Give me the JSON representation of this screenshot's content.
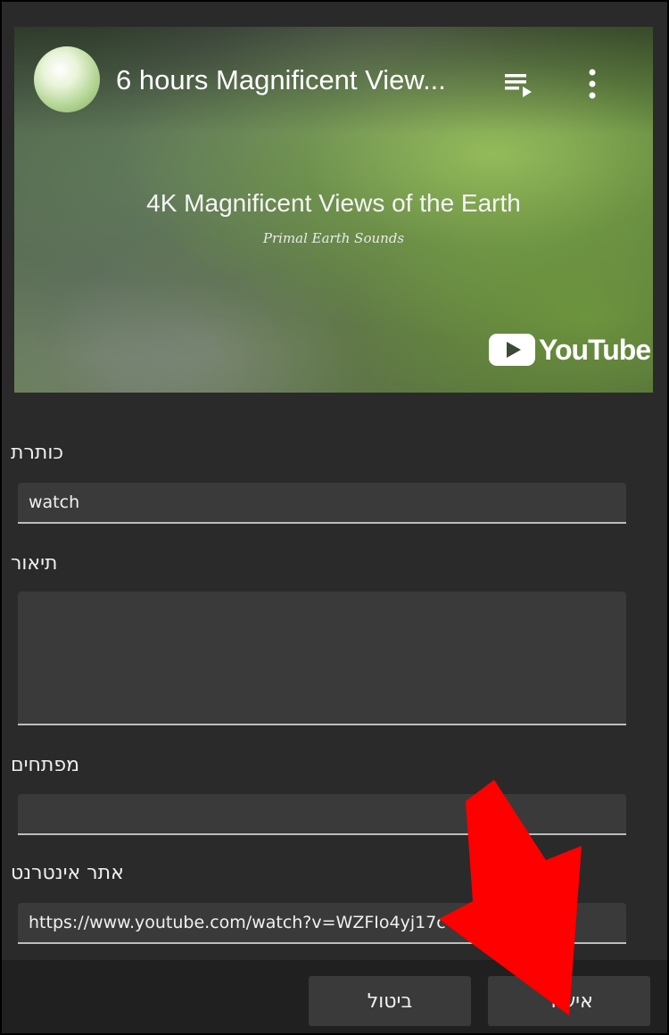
{
  "video": {
    "title": "6 hours Magnificent View...",
    "overlay_title": "4K Magnificent Views of the Earth",
    "overlay_subtitle": "Primal Earth Sounds",
    "brand": "YouTube",
    "brand_color": "#ffffff",
    "playlist_icon": "playlist-play-icon",
    "more_icon": "more-vert-icon"
  },
  "form": {
    "title_label": "כותרת",
    "title_value": "watch",
    "description_label": "תיאור",
    "description_value": "",
    "keywords_label": "מפתחים",
    "keywords_value": "",
    "website_label": "אתר אינטרנט",
    "website_value": "https://www.youtube.com/watch?v=WZFIo4yj17c"
  },
  "buttons": {
    "cancel": "ביטול",
    "confirm": "אישור"
  },
  "annotation": {
    "arrow_color": "#ff0000"
  }
}
